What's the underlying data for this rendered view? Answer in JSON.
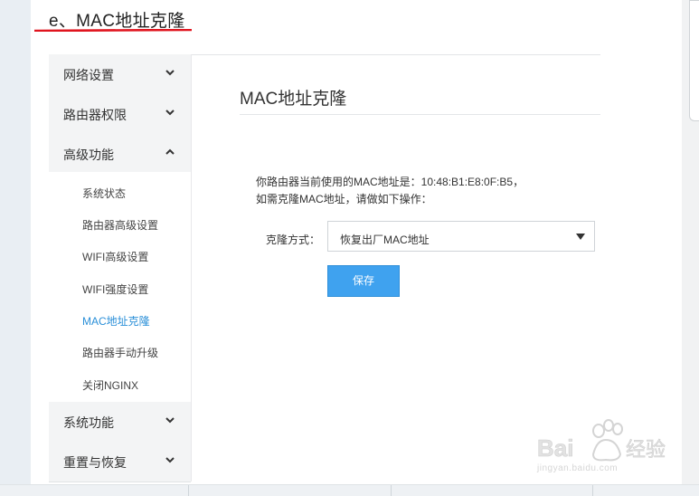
{
  "step_title": "e、MAC地址克隆",
  "sidebar": {
    "groups": [
      {
        "label": "网络设置",
        "expanded": false
      },
      {
        "label": "路由器权限",
        "expanded": false
      },
      {
        "label": "高级功能",
        "expanded": true
      },
      {
        "label": "系统功能",
        "expanded": false
      },
      {
        "label": "重置与恢复",
        "expanded": false
      }
    ],
    "sub_items": [
      {
        "label": "系统状态"
      },
      {
        "label": "路由器高级设置"
      },
      {
        "label": "WIFI高级设置"
      },
      {
        "label": "WIFI强度设置"
      },
      {
        "label": "MAC地址克隆",
        "active": true
      },
      {
        "label": "路由器手动升级"
      },
      {
        "label": "关闭NGINX"
      }
    ]
  },
  "panel": {
    "title": "MAC地址克隆",
    "info_line1": "你路由器当前使用的MAC地址是：10:48:B1:E8:0F:B5，",
    "info_line2": "如需克隆MAC地址，请做如下操作：",
    "clone_label": "克隆方式：",
    "clone_value": "恢复出厂MAC地址",
    "save_label": "保存"
  },
  "watermark": {
    "brand": "Bai du 经验",
    "url": "jingyan.baidu.com"
  },
  "colors": {
    "accent": "#3fa2ef",
    "active_link": "#2a8fd8",
    "underline": "#e0141e"
  }
}
